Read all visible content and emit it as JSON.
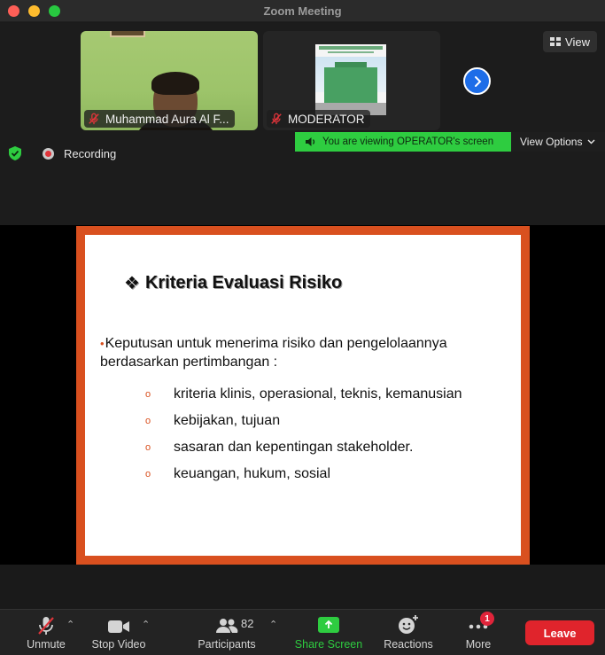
{
  "window": {
    "title": "Zoom Meeting"
  },
  "tiles": [
    {
      "name": "Muhammad Aura Al F..."
    },
    {
      "name": "MODERATOR"
    }
  ],
  "view_button": {
    "label": "View"
  },
  "share_banner": {
    "text": "You are viewing OPERATOR's screen",
    "color": "#2ecc40"
  },
  "view_options": {
    "label": "View Options"
  },
  "recording": {
    "label": "Recording"
  },
  "slide": {
    "title": "Kriteria Evaluasi Risiko",
    "main_point": "Keputusan untuk menerima risiko dan pengelolaannya berdasarkan pertimbangan :",
    "sub_points": [
      "kriteria klinis, operasional, teknis, kemanusian",
      "kebijakan, tujuan",
      "sasaran dan kepentingan stakeholder.",
      "keuangan, hukum, sosial"
    ],
    "border_color": "#d9501f"
  },
  "toolbar": {
    "unmute": "Unmute",
    "stop_video": "Stop Video",
    "participants_label": "Participants",
    "participants_count": "82",
    "share_screen": "Share Screen",
    "reactions": "Reactions",
    "more": "More",
    "more_badge": "1",
    "leave": "Leave"
  }
}
